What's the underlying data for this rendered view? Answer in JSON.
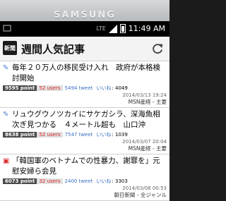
{
  "device": {
    "brand": "SAMSUNG"
  },
  "status_bar": {
    "network": "LTE",
    "time": "11:49 AM"
  },
  "app": {
    "icon_text": "新聞",
    "title": "週間人気記事"
  },
  "articles": [
    {
      "title": "毎年２０万人の移民受け入れ　政府が本格検討開始",
      "points": "9595 point",
      "users": "52 users",
      "tweets": "5494 tweet",
      "likes_label": "いいね",
      "likes": ": 4049",
      "date": "2014/03/13 19:24",
      "source": "MSN産経 - 主要"
    },
    {
      "title": "リュウグウノツカイにサケガシラ、深海魚相次ぎ見つかる　４メートル超も　山口沖",
      "points": "8638 point",
      "users": "52 users",
      "tweets": "7547 tweet",
      "likes_label": "いいね",
      "likes": ": 1039",
      "date": "2014/03/07 20:04",
      "source": "MSN産経 - 主要"
    },
    {
      "title": "「韓国軍のベトナムでの性暴力、謝罪を」元慰安婦ら会見",
      "points": "6073 point",
      "users": "32 users",
      "tweets": "2400 tweet",
      "likes_label": "いいね",
      "likes": ": 3303",
      "date": "2014/03/08 00:53",
      "source": "朝日新聞 - 全ジャンル"
    }
  ]
}
